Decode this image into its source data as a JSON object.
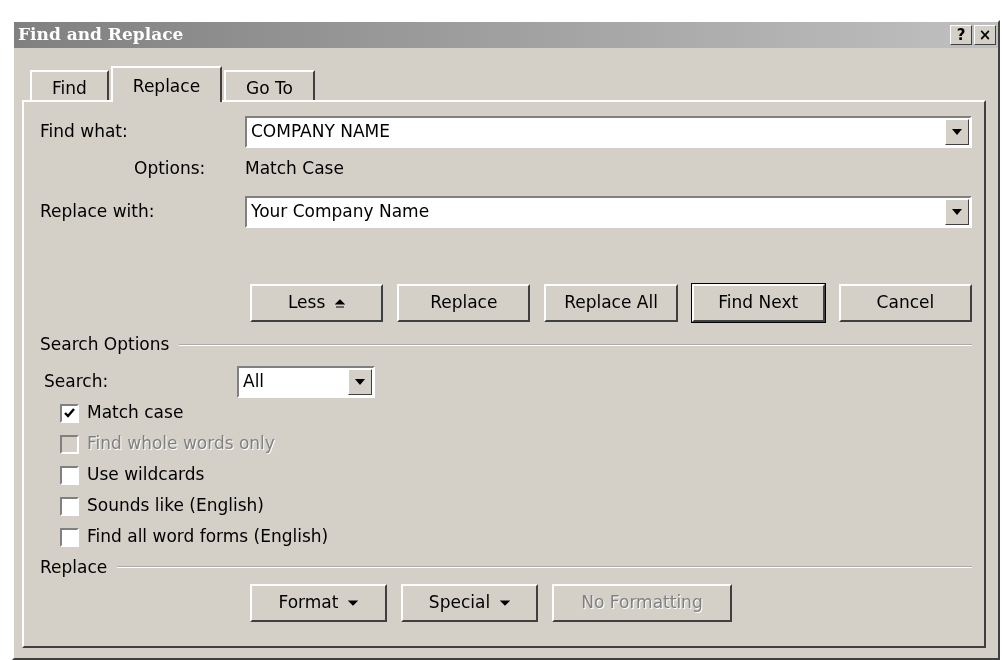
{
  "window": {
    "title": "Find and Replace",
    "title_buttons": [
      "?",
      "×"
    ]
  },
  "tabs": [
    {
      "label": "Find",
      "selected": false
    },
    {
      "label": "Replace",
      "selected": true
    },
    {
      "label": "Go To",
      "selected": false
    }
  ],
  "find_what": {
    "label": "Find what:",
    "value": "COMPANY NAME",
    "options_label": "Options:",
    "options_value": "Match Case"
  },
  "replace_with": {
    "label": "Replace with:",
    "value": "Your Company Name"
  },
  "action_buttons": [
    {
      "label": "Less",
      "kind": "collapse",
      "default": false
    },
    {
      "label": "Replace",
      "default": false
    },
    {
      "label": "Replace All",
      "default": false
    },
    {
      "label": "Find Next",
      "default": true
    },
    {
      "label": "Cancel",
      "default": false
    }
  ],
  "search_options": {
    "title": "Search Options",
    "search_label": "Search:",
    "search_value": "All",
    "checkboxes": [
      {
        "label": "Match case",
        "checked": true,
        "disabled": false
      },
      {
        "label": "Find whole words only",
        "checked": false,
        "disabled": true
      },
      {
        "label": "Use wildcards",
        "checked": false,
        "disabled": false
      },
      {
        "label": "Sounds like (English)",
        "checked": false,
        "disabled": false
      },
      {
        "label": "Find all word forms (English)",
        "checked": false,
        "disabled": false
      }
    ]
  },
  "replace_section": {
    "title": "Replace",
    "buttons": [
      {
        "label": "Format",
        "kind": "menu",
        "disabled": false
      },
      {
        "label": "Special",
        "kind": "menu",
        "disabled": false
      },
      {
        "label": "No Formatting",
        "disabled": true
      }
    ]
  }
}
